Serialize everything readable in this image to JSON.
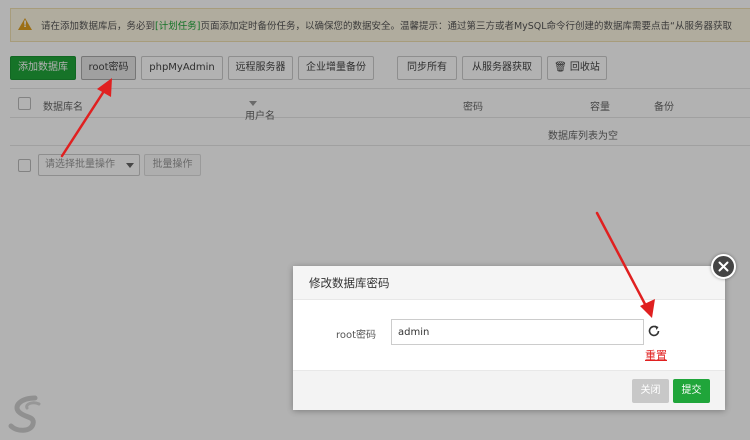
{
  "notice": {
    "text_before": "请在添加数据库后，务必到",
    "link": "[计划任务]",
    "text_after": "页面添加定时备份任务，以确保您的数据安全。温馨提示：通过第三方或者MySQL命令行创建的数据库需要点击“从服务器获取"
  },
  "toolbar": {
    "add_db": "添加数据库",
    "root_pwd": "root密码",
    "phpmyadmin": "phpMyAdmin",
    "remote_server": "远程服务器",
    "enterprise_backup": "企业增量备份",
    "sync_all": "同步所有",
    "fetch_from_server": "从服务器获取",
    "recycle_bin": "回收站"
  },
  "table": {
    "headers": {
      "name": "数据库名",
      "username": "用户名",
      "password": "密码",
      "capacity": "容量",
      "backup": "备份"
    },
    "empty": "数据库列表为空"
  },
  "bulk": {
    "select_placeholder": "请选择批量操作",
    "button": "批量操作"
  },
  "dialog": {
    "title": "修改数据库密码",
    "label": "root密码",
    "value": "admin",
    "reset": "重置",
    "close": "关闭",
    "submit": "提交"
  },
  "colors": {
    "primary": "#20a53a",
    "annotation": "#e02020",
    "warning": "#e0a020"
  },
  "icons": [
    "warning-icon",
    "trash-icon",
    "sort-down-icon",
    "chevron-down-icon",
    "refresh-icon",
    "close-icon",
    "logo-icon"
  ]
}
